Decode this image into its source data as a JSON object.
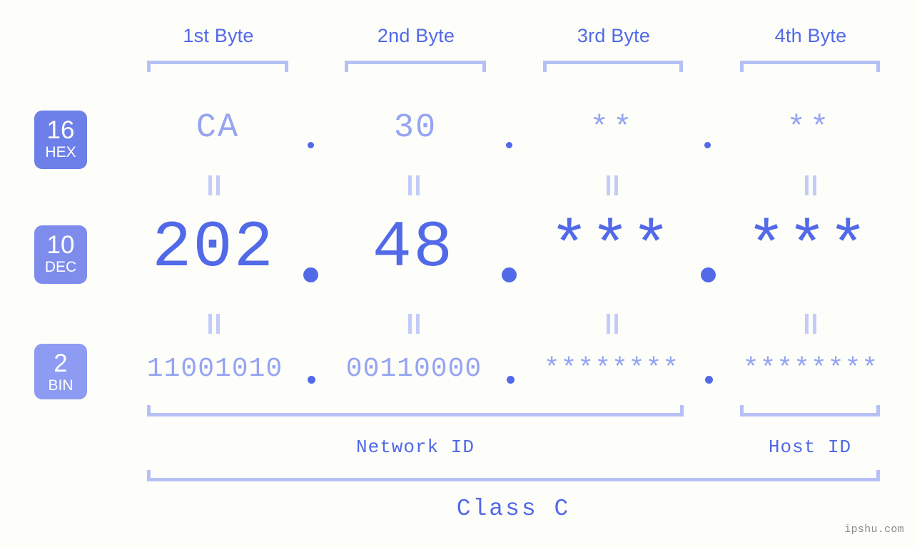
{
  "page": {
    "background_color": "#fdfefa",
    "accent_color": "#5269e8",
    "accent_light_color": "#96a4f2",
    "bracket_color": "#b6c0f7",
    "watermark": "ipshu.com"
  },
  "byte_headers": [
    {
      "label": "1st Byte"
    },
    {
      "label": "2nd Byte"
    },
    {
      "label": "3rd Byte"
    },
    {
      "label": "4th Byte"
    }
  ],
  "bases": [
    {
      "number": "16",
      "name": "HEX",
      "color": "#6d7fe8"
    },
    {
      "number": "10",
      "name": "DEC",
      "color": "#7e8cec"
    },
    {
      "number": "2",
      "name": "BIN",
      "color": "#8d9bf2"
    }
  ],
  "rows": {
    "hex": {
      "values": [
        "CA",
        "30",
        "**",
        "**"
      ]
    },
    "dec": {
      "values": [
        "202",
        "48",
        "***",
        "***"
      ]
    },
    "bin": {
      "values": [
        "11001010",
        "00110000",
        "********",
        "********"
      ]
    }
  },
  "separators": {
    "symbol": "."
  },
  "equality": {
    "symbol": "="
  },
  "segments": {
    "network_id": "Network ID",
    "host_id": "Host ID",
    "class": "Class C"
  }
}
